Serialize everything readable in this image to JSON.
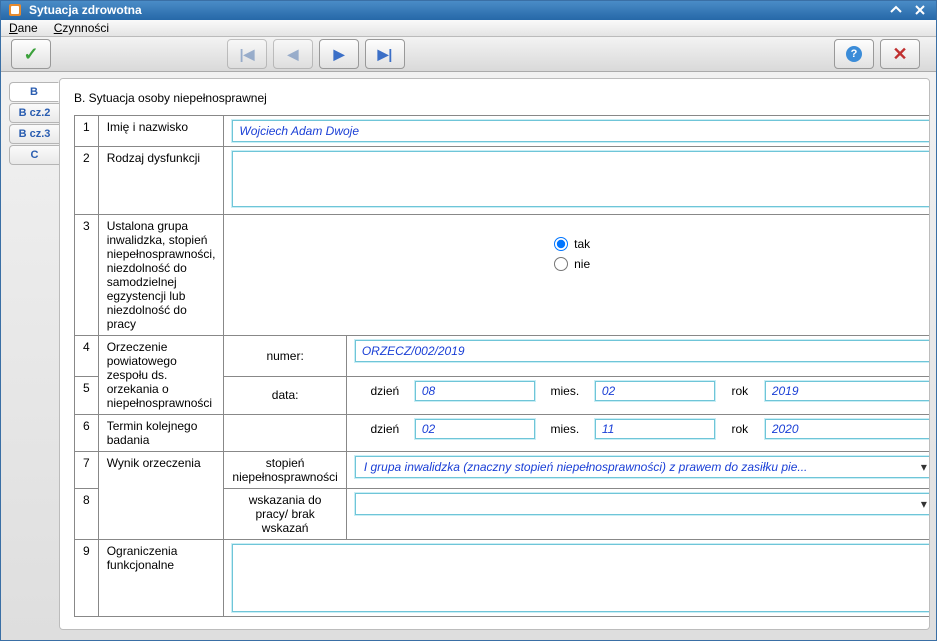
{
  "window": {
    "title": "Sytuacja zdrowotna"
  },
  "menu": {
    "dane": "Dane",
    "czynnosci": "Czynności"
  },
  "tabs": {
    "b": "B",
    "bcz2": "B cz.2",
    "bcz3": "B cz.3",
    "c": "C"
  },
  "section": {
    "title": "B. Sytuacja osoby niepełnosprawnej"
  },
  "rows": {
    "r1": {
      "n": "1",
      "label": "Imię i nazwisko",
      "value": "Wojciech Adam Dwoje"
    },
    "r2": {
      "n": "2",
      "label": "Rodzaj dysfunkcji",
      "value": ""
    },
    "r3": {
      "n": "3",
      "label": "Ustalona grupa inwalidzka, stopień niepełnosprawności, niezdolność do samodzielnej egzystencji lub niezdolność do pracy",
      "opt_tak": "tak",
      "opt_nie": "nie",
      "selected": "tak"
    },
    "r4": {
      "n": "4",
      "label": "Orzeczenie powiatowego zespołu ds. orzekania o niepełnosprawności",
      "numer_label": "numer:",
      "numer_value": "ORZECZ/002/2019"
    },
    "r5": {
      "n": "5",
      "data_label": "data:",
      "dzien_label": "dzień",
      "dzien": "08",
      "mies_label": "mies.",
      "mies": "02",
      "rok_label": "rok",
      "rok": "2019"
    },
    "r6": {
      "n": "6",
      "label": "Termin kolejnego badania",
      "dzien_label": "dzień",
      "dzien": "02",
      "mies_label": "mies.",
      "mies": "11",
      "rok_label": "rok",
      "rok": "2020"
    },
    "r7": {
      "n": "7",
      "label": "Wynik orzeczenia",
      "sub_label": "stopień niepełnosprawności",
      "dropdown": "I grupa inwalidzka (znaczny stopień niepełnosprawności) z prawem do zasiłku pie..."
    },
    "r8": {
      "n": "8",
      "sub_label": "wskazania do pracy/ brak wskazań",
      "dropdown": ""
    },
    "r9": {
      "n": "9",
      "label": "Ograniczenia funkcjonalne",
      "value": ""
    }
  }
}
